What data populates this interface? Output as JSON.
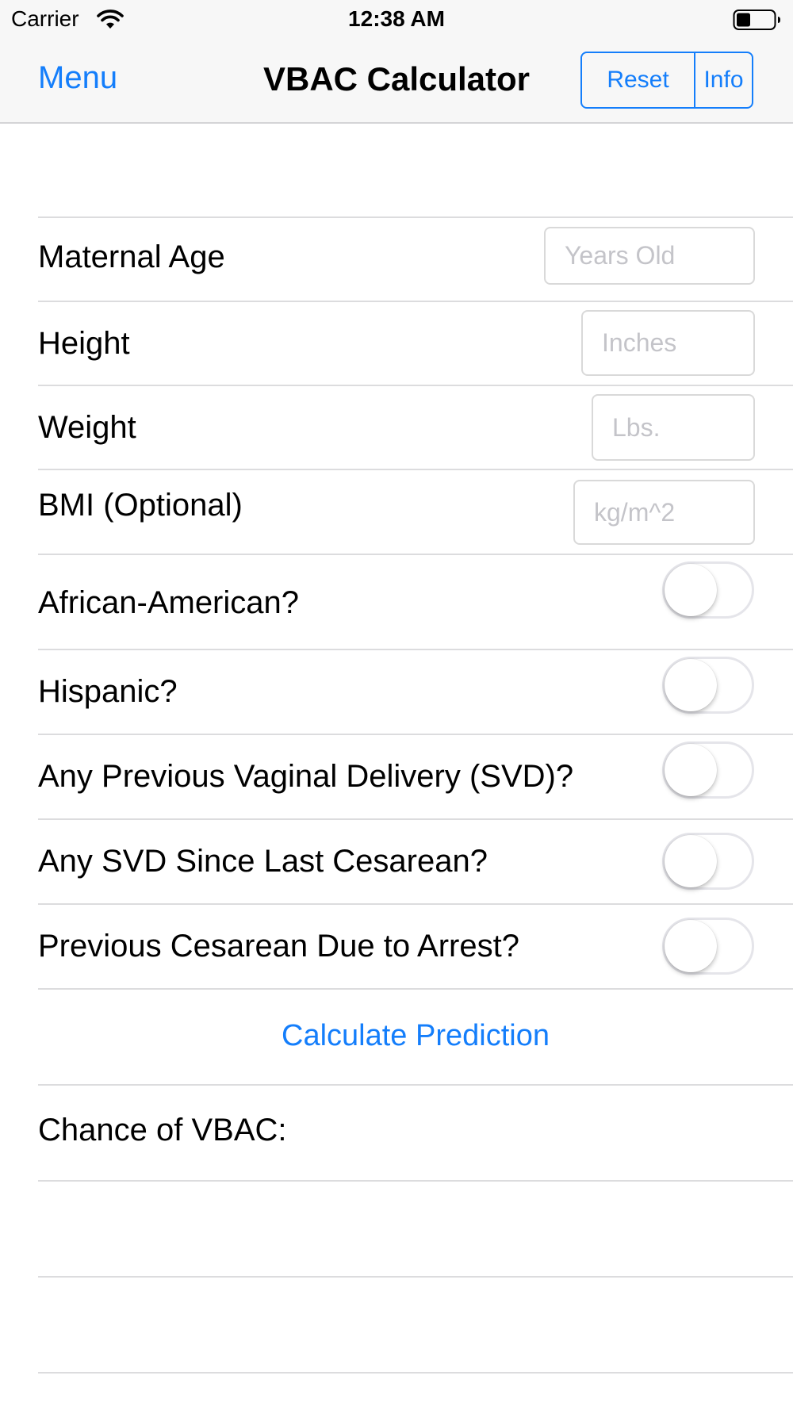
{
  "status_bar": {
    "carrier": "Carrier",
    "time": "12:38 AM",
    "wifi_icon": "wifi-icon",
    "battery_icon": "battery-icon"
  },
  "nav": {
    "menu_label": "Menu",
    "title": "VBAC Calculator",
    "reset_label": "Reset",
    "info_label": "Info",
    "accent_color": "#147efb"
  },
  "form": {
    "maternal_age": {
      "label": "Maternal Age",
      "value": "",
      "placeholder": "Years Old"
    },
    "height": {
      "label": "Height",
      "value": "",
      "placeholder": "Inches"
    },
    "weight": {
      "label": "Weight",
      "value": "",
      "placeholder": "Lbs."
    },
    "bmi": {
      "label": "BMI (Optional)",
      "value": "",
      "placeholder": "kg/m^2"
    },
    "african_american": {
      "label": "African-American?",
      "on": false
    },
    "hispanic": {
      "label": "Hispanic?",
      "on": false
    },
    "previous_svd": {
      "label": "Any Previous Vaginal Delivery (SVD)?",
      "on": false
    },
    "svd_since_cesarean": {
      "label": "Any SVD Since Last Cesarean?",
      "on": false
    },
    "cesarean_arrest": {
      "label": "Previous Cesarean Due to Arrest?",
      "on": false
    },
    "calculate_label": "Calculate Prediction",
    "result_label": "Chance of VBAC:"
  }
}
